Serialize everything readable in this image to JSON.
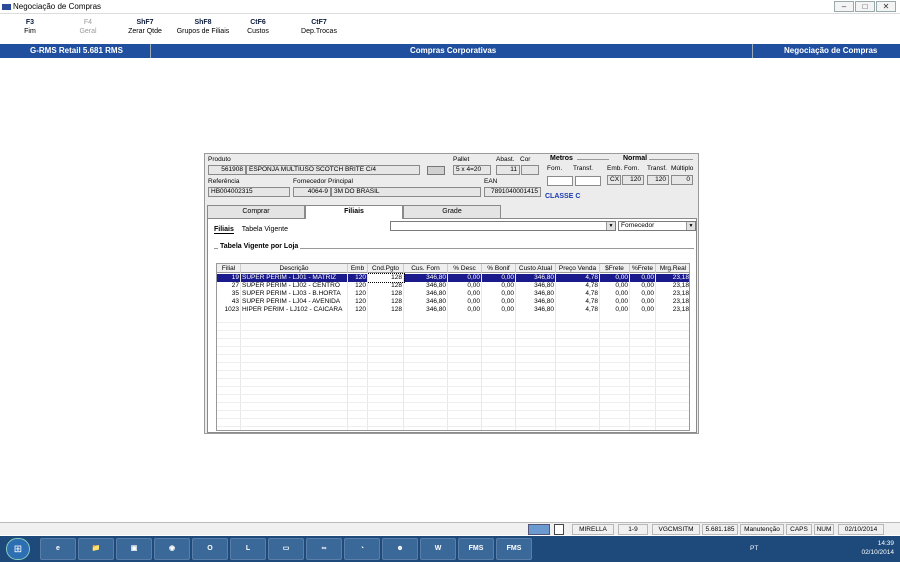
{
  "window": {
    "title": "Negociação de Compras",
    "buttons": [
      "–",
      "□",
      "✕"
    ]
  },
  "fkeys": [
    {
      "code": "F3",
      "label": "Fim",
      "enabled": true
    },
    {
      "code": "F4",
      "label": "Geral",
      "enabled": false
    },
    {
      "code": "ShF7",
      "label": "Zerar Qtde",
      "enabled": true
    },
    {
      "code": "ShF8",
      "label": "Grupos de Filiais",
      "enabled": true
    },
    {
      "code": "CtF6",
      "label": "Custos",
      "enabled": true
    },
    {
      "code": "CtF7",
      "label": "Dep.Trocas",
      "enabled": true
    }
  ],
  "bluebar": {
    "left": "G-RMS Retail 5.681 RMS",
    "center": "Compras Corporativas",
    "right": "Negociação de Compras"
  },
  "product": {
    "produto_label": "Produto",
    "produto_code": "561908",
    "produto_desc": "ESPONJA MULTIUSO SCOTCH BRITE C/4",
    "pallet_label": "Pallet",
    "pallet_value": "5 x 4=20",
    "abast_label": "Abast.",
    "abast_value": "11",
    "cor_label": "Cor",
    "cor_value": "",
    "referencia_label": "Referência",
    "referencia_value": "HB004002315",
    "fornecedor_label": "Fornecedor Principal",
    "fornecedor_code": "4064-9",
    "fornecedor_name": "3M DO BRASIL",
    "ean_label": "EAN",
    "ean_value": "7891040001415",
    "classe": "CLASSE C"
  },
  "metros": {
    "title": "Metros",
    "forn_label": "Forn.",
    "transf_label": "Transf.",
    "forn_value": "",
    "transf_value": ""
  },
  "normal": {
    "title": "Normal",
    "emb_label": "Emb. Forn.",
    "transf_label": "Transf.",
    "mult_label": "Múltiplo",
    "emb_unit": "CX",
    "emb_value": "120",
    "transf_value": "120",
    "mult_value": "0"
  },
  "tabs": [
    {
      "label": "Comprar",
      "active": false
    },
    {
      "label": "Filiais",
      "active": true
    },
    {
      "label": "Grade",
      "active": false
    }
  ],
  "subtabs": [
    {
      "label": "Filiais",
      "active": true
    },
    {
      "label": "Tabela Vigente",
      "active": false
    }
  ],
  "filter": {
    "value": "",
    "sort": "Fornecedor"
  },
  "table": {
    "title": "Tabela Vigente por Loja",
    "columns": [
      "Filial",
      "Descrição",
      "Emb",
      "Cnd.Pgto",
      "Cus. Forn",
      "% Desc",
      "% Bonif",
      "Custo Atual",
      "Preço Venda",
      "$Frete",
      "%Frete",
      "Mrg.Real"
    ],
    "rows": [
      [
        "19",
        "SUPER PERIM - LJ01 - MATRIZ",
        "120",
        "128",
        "346,80",
        "0,00",
        "0,00",
        "346,80",
        "4,78",
        "0,00",
        "0,00",
        "23,18"
      ],
      [
        "27",
        "SUPER PERIM - LJ02 - CENTRO",
        "120",
        "128",
        "346,80",
        "0,00",
        "0,00",
        "346,80",
        "4,78",
        "0,00",
        "0,00",
        "23,18"
      ],
      [
        "35",
        "SUPER PERIM - LJ03 - B.HORTA",
        "120",
        "128",
        "346,80",
        "0,00",
        "0,00",
        "346,80",
        "4,78",
        "0,00",
        "0,00",
        "23,18"
      ],
      [
        "43",
        "SUPER PERIM - LJ04 - AVENIDA",
        "120",
        "128",
        "346,80",
        "0,00",
        "0,00",
        "346,80",
        "4,78",
        "0,00",
        "0,00",
        "23,18"
      ],
      [
        "1023",
        "HIPER PERIM - LJ102 - CAICARA",
        "120",
        "128",
        "346,80",
        "0,00",
        "0,00",
        "346,80",
        "4,78",
        "0,00",
        "0,00",
        "23,18"
      ]
    ]
  },
  "status": {
    "user": "MIRELLA",
    "range": "1-9",
    "db": "VGCMSITM",
    "version": "5.681.185",
    "mode": "Manutenção",
    "caps": "CAPS",
    "num": "NUM",
    "date": "02/10/2014"
  },
  "taskbar": {
    "items": [
      "e",
      "📁",
      "▣",
      "◉",
      "O",
      "L",
      "▭",
      "∞",
      "◔",
      "☻",
      "W",
      "FMS",
      "FMS"
    ],
    "lang": "PT",
    "time": "14:39",
    "date": "02/10/2014"
  }
}
